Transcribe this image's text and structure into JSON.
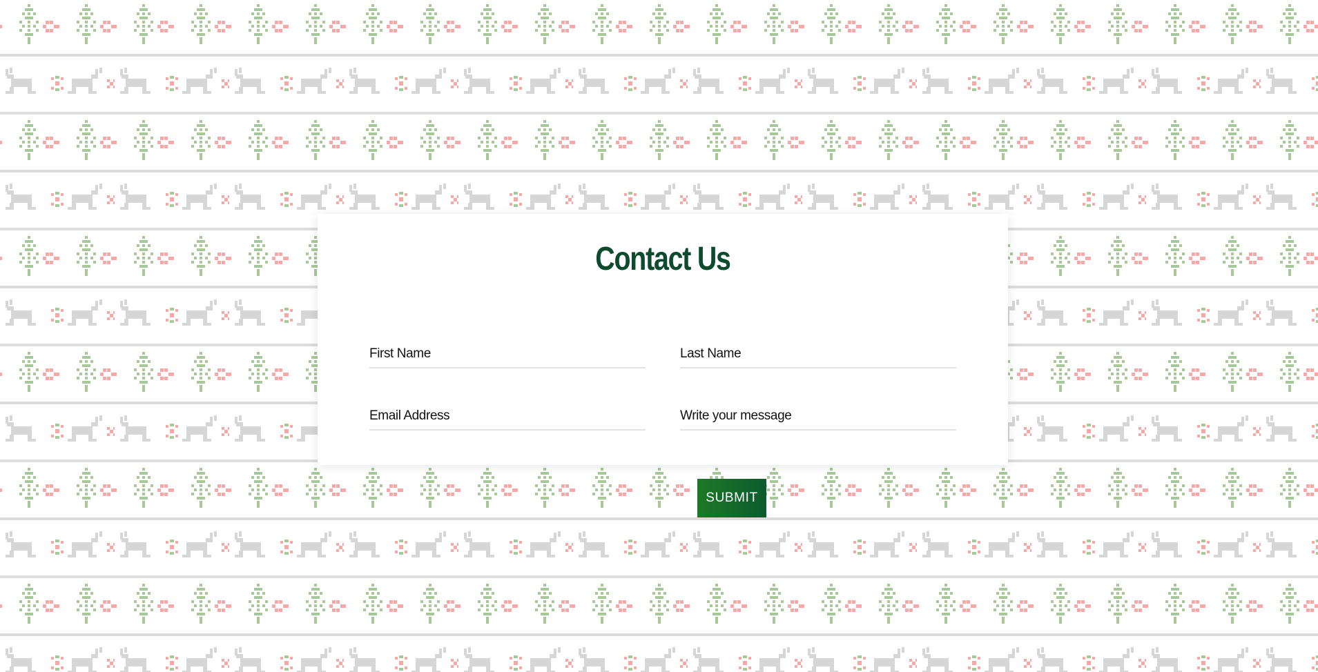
{
  "page": {
    "background_colors": {
      "tree": "#a8c89a",
      "diamond": "#f6a8a6",
      "reindeer": "#d6d6d6",
      "stripe": "#dcdcdc",
      "snowflake_accent": "#a8c89a"
    },
    "accent_color": "#0d4a2e"
  },
  "contact": {
    "title": "Contact Us",
    "fields": {
      "first_name": {
        "value": "",
        "placeholder": "First Name"
      },
      "last_name": {
        "value": "",
        "placeholder": "Last Name"
      },
      "email": {
        "value": "",
        "placeholder": "Email Address"
      },
      "message": {
        "value": "",
        "placeholder": "Write your message"
      }
    },
    "submit_label": "SUBMIT"
  }
}
